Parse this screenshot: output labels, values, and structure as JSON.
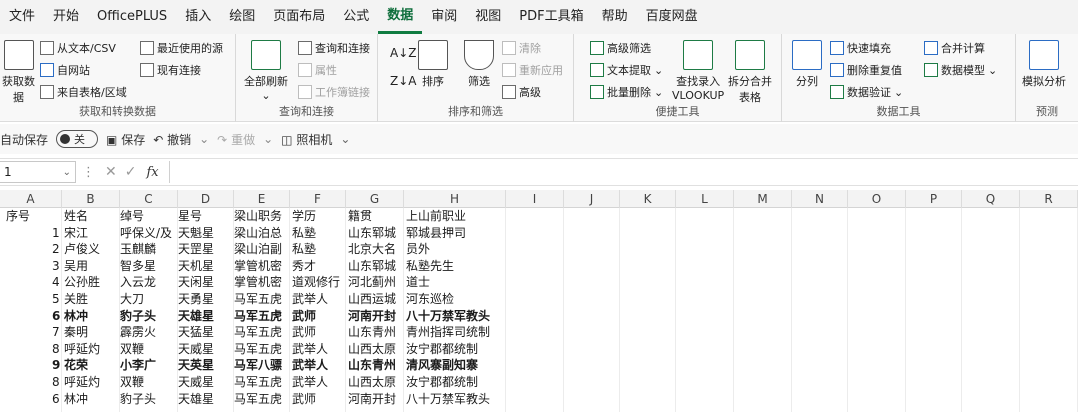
{
  "menu": [
    "文件",
    "开始",
    "OfficePLUS",
    "插入",
    "绘图",
    "页面布局",
    "公式",
    "数据",
    "审阅",
    "视图",
    "PDF工具箱",
    "帮助",
    "百度网盘"
  ],
  "active_menu_index": 7,
  "ribbon": {
    "get_data": {
      "big_label_1": "获取数",
      "big_label_2": "据",
      "items": [
        "从文本/CSV",
        "自网站",
        "来自表格/区域",
        "最近使用的源",
        "现有连接"
      ],
      "title": "获取和转换数据"
    },
    "query": {
      "refresh_label": "全部刷新",
      "items": [
        "查询和连接",
        "属性",
        "工作簿链接"
      ],
      "title": "查询和连接"
    },
    "sort": {
      "sort_label": "排序",
      "filter_label": "筛选",
      "items": [
        "清除",
        "重新应用",
        "高级"
      ],
      "title": "排序和筛选"
    },
    "tools": {
      "items": [
        "高级筛选",
        "文本提取",
        "批量删除"
      ],
      "vlookup_label_1": "查找录入",
      "vlookup_label_2": "VLOOKUP",
      "merge_label_1": "拆分合并",
      "merge_label_2": "表格",
      "title": "便捷工具"
    },
    "data_tools": {
      "split_label": "分列",
      "items": [
        "快速填充",
        "删除重复值",
        "数据验证",
        "合并计算",
        "数据模型"
      ],
      "title": "数据工具"
    },
    "forecast": {
      "label": "模拟分析",
      "title": "预测"
    }
  },
  "qat": {
    "autosave_label": "自动保存",
    "toggle_label": "关",
    "save_label": "保存",
    "undo_label": "撤销",
    "redo_label": "重做",
    "camera_label": "照相机"
  },
  "formula_bar": {
    "name_box": "1",
    "value": ""
  },
  "columns": [
    "A",
    "B",
    "C",
    "D",
    "E",
    "F",
    "G",
    "H",
    "I",
    "J",
    "K",
    "L",
    "M",
    "N",
    "O",
    "P",
    "Q",
    "R"
  ],
  "sheet": {
    "header": [
      "序号",
      "姓名",
      "绰号",
      "星号",
      "梁山职务",
      "学历",
      "籍贯",
      "上山前职业"
    ],
    "rows": [
      {
        "bold": false,
        "cells": [
          "1",
          "宋江",
          "呼保义/及",
          "天魁星",
          "梁山泊总",
          "私塾",
          "山东郓城",
          "郓城县押司"
        ]
      },
      {
        "bold": false,
        "cells": [
          "2",
          "卢俊义",
          "玉麒麟",
          "天罡星",
          "梁山泊副",
          "私塾",
          "北京大名",
          "员外"
        ]
      },
      {
        "bold": false,
        "cells": [
          "3",
          "吴用",
          "智多星",
          "天机星",
          "掌管机密",
          "秀才",
          "山东郓城",
          "私塾先生"
        ]
      },
      {
        "bold": false,
        "cells": [
          "4",
          "公孙胜",
          "入云龙",
          "天闲星",
          "掌管机密",
          "道观修行",
          "河北蓟州",
          "道士"
        ]
      },
      {
        "bold": false,
        "cells": [
          "5",
          "关胜",
          "大刀",
          "天勇星",
          "马军五虎",
          "武举人",
          "山西运城",
          "河东巡检"
        ]
      },
      {
        "bold": true,
        "cells": [
          "6",
          "林冲",
          "豹子头",
          "天雄星",
          "马军五虎",
          "武师",
          "河南开封",
          "八十万禁军教头"
        ]
      },
      {
        "bold": false,
        "cells": [
          "7",
          "秦明",
          "霹雳火",
          "天猛星",
          "马军五虎",
          "武师",
          "山东青州",
          "青州指挥司统制"
        ]
      },
      {
        "bold": false,
        "cells": [
          "8",
          "呼延灼",
          "双鞭",
          "天威星",
          "马军五虎",
          "武举人",
          "山西太原",
          "汝宁郡都统制"
        ]
      },
      {
        "bold": true,
        "cells": [
          "9",
          "花荣",
          "小李广",
          "天英星",
          "马军八骠",
          "武举人",
          "山东青州",
          "清风寨副知寨"
        ]
      },
      {
        "bold": false,
        "cells": [
          "8",
          "呼延灼",
          "双鞭",
          "天威星",
          "马军五虎",
          "武举人",
          "山西太原",
          "汝宁郡都统制"
        ]
      },
      {
        "bold": false,
        "cells": [
          "6",
          "林冲",
          "豹子头",
          "天雄星",
          "马军五虎",
          "武师",
          "河南开封",
          "八十万禁军教头"
        ]
      }
    ]
  }
}
